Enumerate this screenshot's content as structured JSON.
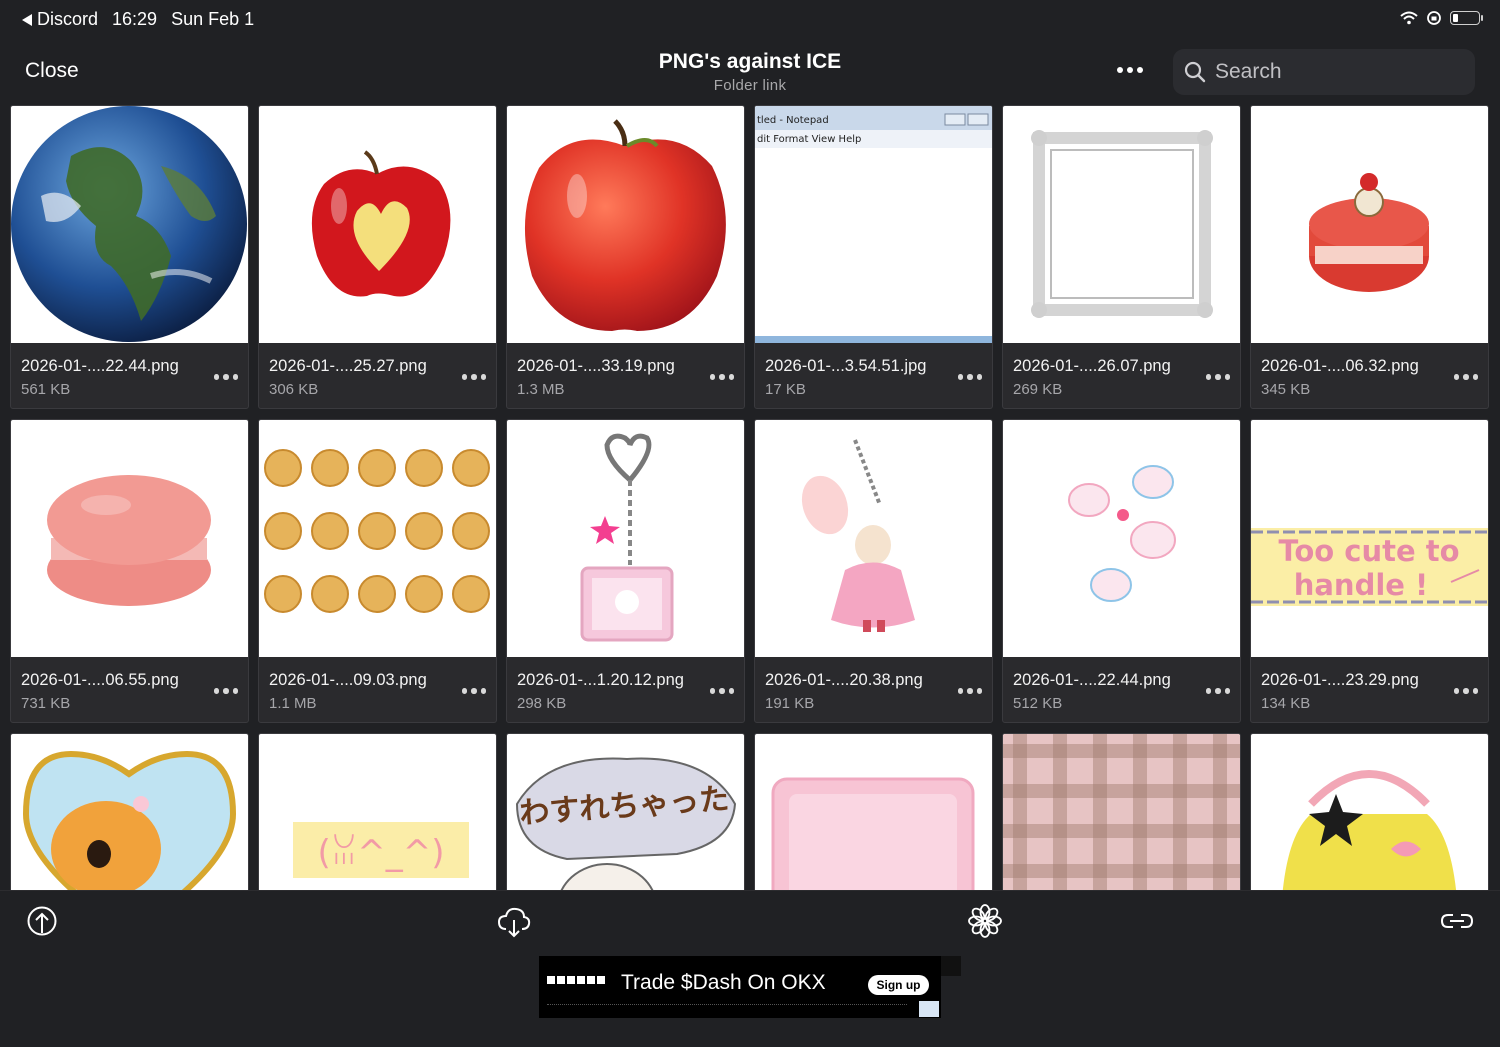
{
  "status_bar": {
    "back_app": "Discord",
    "time": "16:29",
    "date": "Sun Feb 1"
  },
  "nav": {
    "close_label": "Close",
    "title": "PNG's against ICE",
    "subtitle": "Folder link",
    "search_placeholder": "Search"
  },
  "files": [
    {
      "name": "2026-01-....22.44.png",
      "size": "561 KB",
      "thumb": "earth"
    },
    {
      "name": "2026-01-....25.27.png",
      "size": "306 KB",
      "thumb": "apple-heart"
    },
    {
      "name": "2026-01-....33.19.png",
      "size": "1.3 MB",
      "thumb": "apple"
    },
    {
      "name": "2026-01-...3.54.51.jpg",
      "size": "17 KB",
      "thumb": "notepad"
    },
    {
      "name": "2026-01-....26.07.png",
      "size": "269 KB",
      "thumb": "frame"
    },
    {
      "name": "2026-01-....06.32.png",
      "size": "345 KB",
      "thumb": "cake"
    },
    {
      "name": "2026-01-....06.55.png",
      "size": "731 KB",
      "thumb": "macaron"
    },
    {
      "name": "2026-01-....09.03.png",
      "size": "1.1 MB",
      "thumb": "cookies"
    },
    {
      "name": "2026-01-...1.20.12.png",
      "size": "298 KB",
      "thumb": "keychain"
    },
    {
      "name": "2026-01-....20.38.png",
      "size": "191 KB",
      "thumb": "bunny"
    },
    {
      "name": "2026-01-....22.44.png",
      "size": "512 KB",
      "thumb": "stickers"
    },
    {
      "name": "2026-01-....23.29.png",
      "size": "134 KB",
      "thumb": "banner"
    },
    {
      "name": "",
      "size": "",
      "thumb": "fawn"
    },
    {
      "name": "",
      "size": "",
      "thumb": "kaomoji"
    },
    {
      "name": "",
      "size": "",
      "thumb": "hamster"
    },
    {
      "name": "",
      "size": "",
      "thumb": "tray"
    },
    {
      "name": "",
      "size": "",
      "thumb": "plaid"
    },
    {
      "name": "",
      "size": "",
      "thumb": "bag"
    }
  ],
  "thumb_texts": {
    "notepad_title": "tled - Notepad",
    "notepad_menu": "dit   Format   View   Help",
    "banner_line1": "Too cute to",
    "banner_line2": "handle !",
    "kaomoji": "(ꈍ^_^)",
    "hamster_text": "わすれちゃった"
  },
  "toolbar": [
    {
      "name": "upload-icon"
    },
    {
      "name": "cloud-download-icon"
    },
    {
      "name": "photos-icon"
    },
    {
      "name": "link-icon"
    }
  ],
  "ad": {
    "text": "Trade $Dash On OKX",
    "cta": "Sign up"
  },
  "colors": {
    "background": "#202124",
    "card": "#2a2a2d",
    "accent_text": "#a8a8aa"
  }
}
